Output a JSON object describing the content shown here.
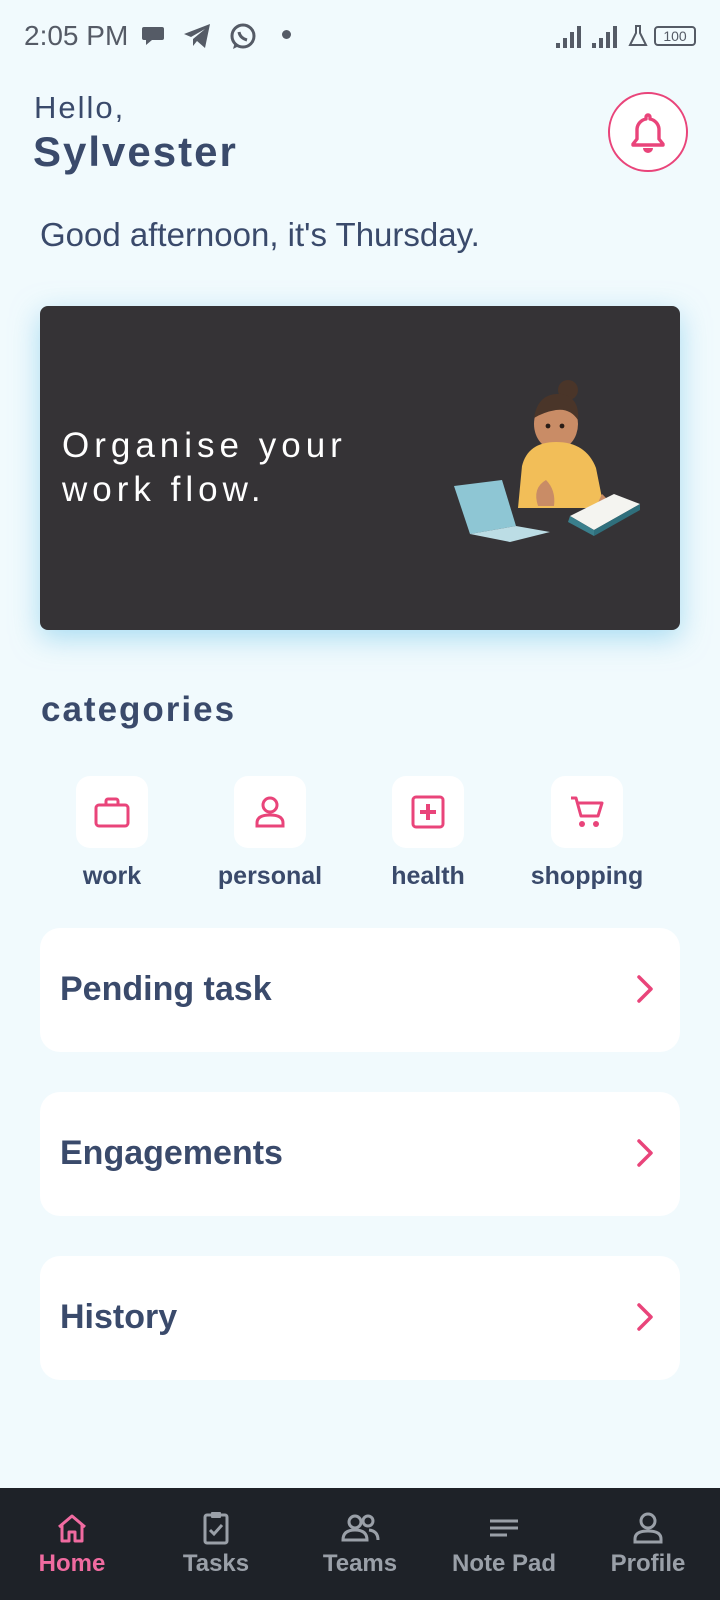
{
  "status_bar": {
    "time": "2:05 PM",
    "notification_icons": [
      "chat-bubble-icon",
      "telegram-icon",
      "whatsapp-icon",
      "dot-icon"
    ],
    "system_icons": [
      "signal-icon",
      "signal-icon",
      "flask-icon"
    ],
    "battery": "100"
  },
  "header": {
    "hello": "Hello,",
    "username": "Sylvester",
    "bell_icon": "bell-icon"
  },
  "greeting": "Good afternoon, it's Thursday.",
  "hero": {
    "text": "Organise your\nwork flow.",
    "illustration": "person-reading-with-laptop"
  },
  "categories": {
    "title": "categories",
    "items": [
      {
        "label": "work",
        "icon": "briefcase-icon"
      },
      {
        "label": "personal",
        "icon": "person-icon"
      },
      {
        "label": "health",
        "icon": "medical-cross-icon"
      },
      {
        "label": "shopping",
        "icon": "cart-icon"
      }
    ]
  },
  "cards": [
    {
      "label": "Pending task"
    },
    {
      "label": "Engagements"
    },
    {
      "label": "History"
    }
  ],
  "bottom_nav": {
    "items": [
      {
        "label": "Home",
        "icon": "home-icon",
        "active": true
      },
      {
        "label": "Tasks",
        "icon": "clipboard-check-icon",
        "active": false
      },
      {
        "label": "Teams",
        "icon": "group-icon",
        "active": false
      },
      {
        "label": "Note Pad",
        "icon": "notes-icon",
        "active": false
      },
      {
        "label": "Profile",
        "icon": "profile-icon",
        "active": false
      }
    ]
  },
  "colors": {
    "background": "#f1fafd",
    "accent": "#e9447a",
    "text": "#3a4a6b",
    "hero_bg": "#353336",
    "nav_bg": "#1e2228",
    "nav_active": "#f06ba0"
  }
}
